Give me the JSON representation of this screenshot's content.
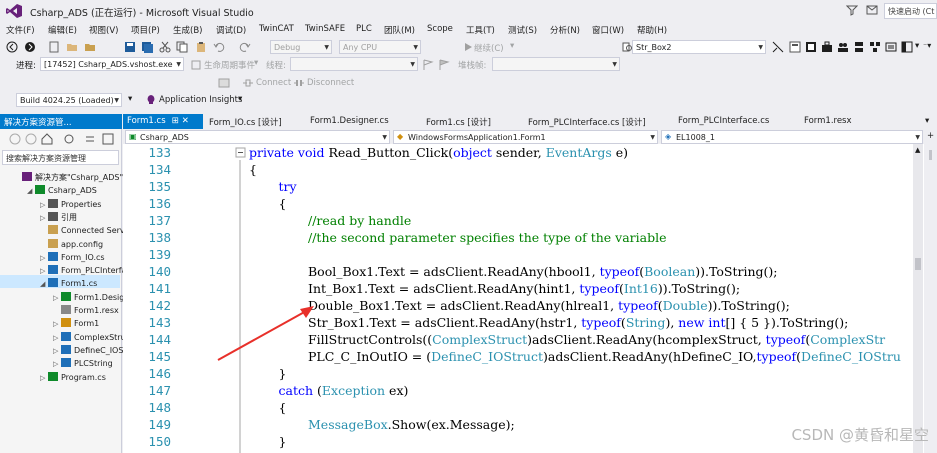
{
  "window": {
    "title": "Csharp_ADS (正在运行) - Microsoft Visual Studio",
    "quick_launch": "快速启动 (Ct"
  },
  "menu": [
    "文件(F)",
    "编辑(E)",
    "视图(V)",
    "项目(P)",
    "生成(B)",
    "调试(D)",
    "TwinCAT",
    "TwinSAFE",
    "PLC",
    "团队(M)",
    "Scope",
    "工具(T)",
    "测试(S)",
    "分析(N)",
    "窗口(W)",
    "帮助(H)"
  ],
  "toolbar1": {
    "config_combo": "Debug",
    "platform_combo": "Any CPU",
    "continue_label": "继续(C)",
    "find_combo": "Str_Box2"
  },
  "toolbar2": {
    "process_label": "进程:",
    "process_value": "[17452] Csharp_ADS.vshost.exe",
    "lifecycle_label": "生命周期事件",
    "thread_label": "线程:",
    "stackframe_label": "堆栈帧:",
    "connect_label": "Connect",
    "disconnect_label": "Disconnect"
  },
  "toolbar3": {
    "build_value": "Build 4024.25 (Loaded)",
    "insights_label": "Application Insights"
  },
  "solution_explorer": {
    "title": "解决方案资源管...",
    "search_placeholder": "搜索解决方案资源管理",
    "items": [
      {
        "label": "解决方案\"Csharp_ADS\"(",
        "indent": 0,
        "expander": "",
        "icon": "solution-icon"
      },
      {
        "label": "Csharp_ADS",
        "indent": 1,
        "expander": "◢",
        "icon": "csproject-icon"
      },
      {
        "label": "Properties",
        "indent": 2,
        "expander": "▷",
        "icon": "properties-icon"
      },
      {
        "label": "引用",
        "indent": 2,
        "expander": "▷",
        "icon": "references-icon"
      },
      {
        "label": "Connected Servic",
        "indent": 2,
        "expander": "",
        "icon": "connected-services-icon"
      },
      {
        "label": "app.config",
        "indent": 2,
        "expander": "",
        "icon": "config-icon"
      },
      {
        "label": "Form_IO.cs",
        "indent": 2,
        "expander": "▷",
        "icon": "form-icon"
      },
      {
        "label": "Form_PLCInterfac",
        "indent": 2,
        "expander": "▷",
        "icon": "form-icon"
      },
      {
        "label": "Form1.cs",
        "indent": 2,
        "expander": "◢",
        "icon": "form-icon"
      },
      {
        "label": "Form1.Design",
        "indent": 3,
        "expander": "▷",
        "icon": "csfile-icon"
      },
      {
        "label": "Form1.resx",
        "indent": 3,
        "expander": "",
        "icon": "resx-icon"
      },
      {
        "label": "Form1",
        "indent": 3,
        "expander": "▷",
        "icon": "class-icon"
      },
      {
        "label": "ComplexStruc",
        "indent": 3,
        "expander": "▷",
        "icon": "struct-icon"
      },
      {
        "label": "DefineC_IOStr",
        "indent": 3,
        "expander": "▷",
        "icon": "struct-icon"
      },
      {
        "label": "PLCString",
        "indent": 3,
        "expander": "▷",
        "icon": "enum-icon"
      },
      {
        "label": "Program.cs",
        "indent": 2,
        "expander": "▷",
        "icon": "csfile-icon"
      }
    ]
  },
  "doc_tabs": [
    "Form1.cs",
    "Form_IO.cs [设计]",
    "Form1.Designer.cs",
    "Form1.cs [设计]",
    "Form_PLCInterface.cs [设计]",
    "Form_PLCInterface.cs",
    "Form1.resx"
  ],
  "navbar": {
    "project": "Csharp_ADS",
    "type": "WindowsFormsApplication1.Form1",
    "member": "EL1008_1"
  },
  "code_lines": [
    {
      "n": "133",
      "indent": 0,
      "tokens": [
        [
          "kw",
          "private "
        ],
        [
          "kw",
          "void "
        ],
        [
          "",
          "Read_Button_Click("
        ],
        [
          "kw",
          "object"
        ],
        [
          "",
          " sender, "
        ],
        [
          "ty",
          "EventArgs"
        ],
        [
          "",
          " e)"
        ]
      ]
    },
    {
      "n": "134",
      "indent": 0,
      "tokens": [
        [
          "",
          "{"
        ]
      ]
    },
    {
      "n": "135",
      "indent": 1,
      "tokens": [
        [
          "kw",
          "try"
        ]
      ]
    },
    {
      "n": "136",
      "indent": 1,
      "tokens": [
        [
          "",
          "{"
        ]
      ]
    },
    {
      "n": "137",
      "indent": 2,
      "tokens": [
        [
          "cm",
          "//read by handle"
        ]
      ]
    },
    {
      "n": "138",
      "indent": 2,
      "tokens": [
        [
          "cm",
          "//the second parameter specifies the type of the variable"
        ]
      ]
    },
    {
      "n": "139",
      "indent": 0,
      "tokens": []
    },
    {
      "n": "140",
      "indent": 2,
      "tokens": [
        [
          "",
          "Bool_Box1.Text = adsClient.ReadAny(hbool1, "
        ],
        [
          "kw",
          "typeof"
        ],
        [
          "",
          "("
        ],
        [
          "ty",
          "Boolean"
        ],
        [
          "",
          "))."
        ],
        [
          "",
          "ToString();"
        ]
      ]
    },
    {
      "n": "141",
      "indent": 2,
      "tokens": [
        [
          "",
          "Int_Box1.Text = adsClient.ReadAny(hint1, "
        ],
        [
          "kw",
          "typeof"
        ],
        [
          "",
          "("
        ],
        [
          "ty",
          "Int16"
        ],
        [
          "",
          ")).ToString();"
        ]
      ]
    },
    {
      "n": "142",
      "indent": 2,
      "tokens": [
        [
          "",
          "Double_Box1.Text = adsClient.ReadAny(hlreal1, "
        ],
        [
          "kw",
          "typeof"
        ],
        [
          "",
          "("
        ],
        [
          "ty",
          "Double"
        ],
        [
          "",
          ")).ToString();"
        ]
      ]
    },
    {
      "n": "143",
      "indent": 2,
      "tokens": [
        [
          "",
          "Str_Box1.Text = adsClient.ReadAny(hstr1, "
        ],
        [
          "kw",
          "typeof"
        ],
        [
          "",
          "("
        ],
        [
          "ty",
          "String"
        ],
        [
          "",
          "), "
        ],
        [
          "kw",
          "new "
        ],
        [
          "kw",
          "int"
        ],
        [
          "",
          "[] { 5 }).ToString();"
        ]
      ]
    },
    {
      "n": "144",
      "indent": 2,
      "tokens": [
        [
          "",
          "FillStructControls(("
        ],
        [
          "ty",
          "ComplexStruct"
        ],
        [
          "",
          ")adsClient.ReadAny(hcomplexStruct, "
        ],
        [
          "kw",
          "typeof"
        ],
        [
          "",
          "("
        ],
        [
          "ty",
          "ComplexStr"
        ]
      ]
    },
    {
      "n": "145",
      "indent": 2,
      "tokens": [
        [
          "",
          "PLC_C_InOutIO = ("
        ],
        [
          "ty",
          "DefineC_IOStruct"
        ],
        [
          "",
          ")adsClient.ReadAny(hDefineC_IO,"
        ],
        [
          "kw",
          "typeof"
        ],
        [
          "",
          "("
        ],
        [
          "ty",
          "DefineC_IOStru"
        ]
      ]
    },
    {
      "n": "146",
      "indent": 1,
      "tokens": [
        [
          "",
          "}"
        ]
      ]
    },
    {
      "n": "147",
      "indent": 1,
      "tokens": [
        [
          "kw",
          "catch "
        ],
        [
          "",
          "("
        ],
        [
          "ty",
          "Exception"
        ],
        [
          "",
          " ex)"
        ]
      ]
    },
    {
      "n": "148",
      "indent": 1,
      "tokens": [
        [
          "",
          "{"
        ]
      ]
    },
    {
      "n": "149",
      "indent": 2,
      "tokens": [
        [
          "ty",
          "MessageBox"
        ],
        [
          "",
          ".Show(ex.Message);"
        ]
      ]
    },
    {
      "n": "150",
      "indent": 1,
      "tokens": [
        [
          "",
          "}"
        ]
      ]
    }
  ],
  "watermark": "CSDN @黄昏和星空",
  "colors": {
    "accent": "#007acc",
    "keyword": "#0000ff",
    "type": "#2b91af",
    "comment": "#008000",
    "arrow": "#e8302a"
  }
}
